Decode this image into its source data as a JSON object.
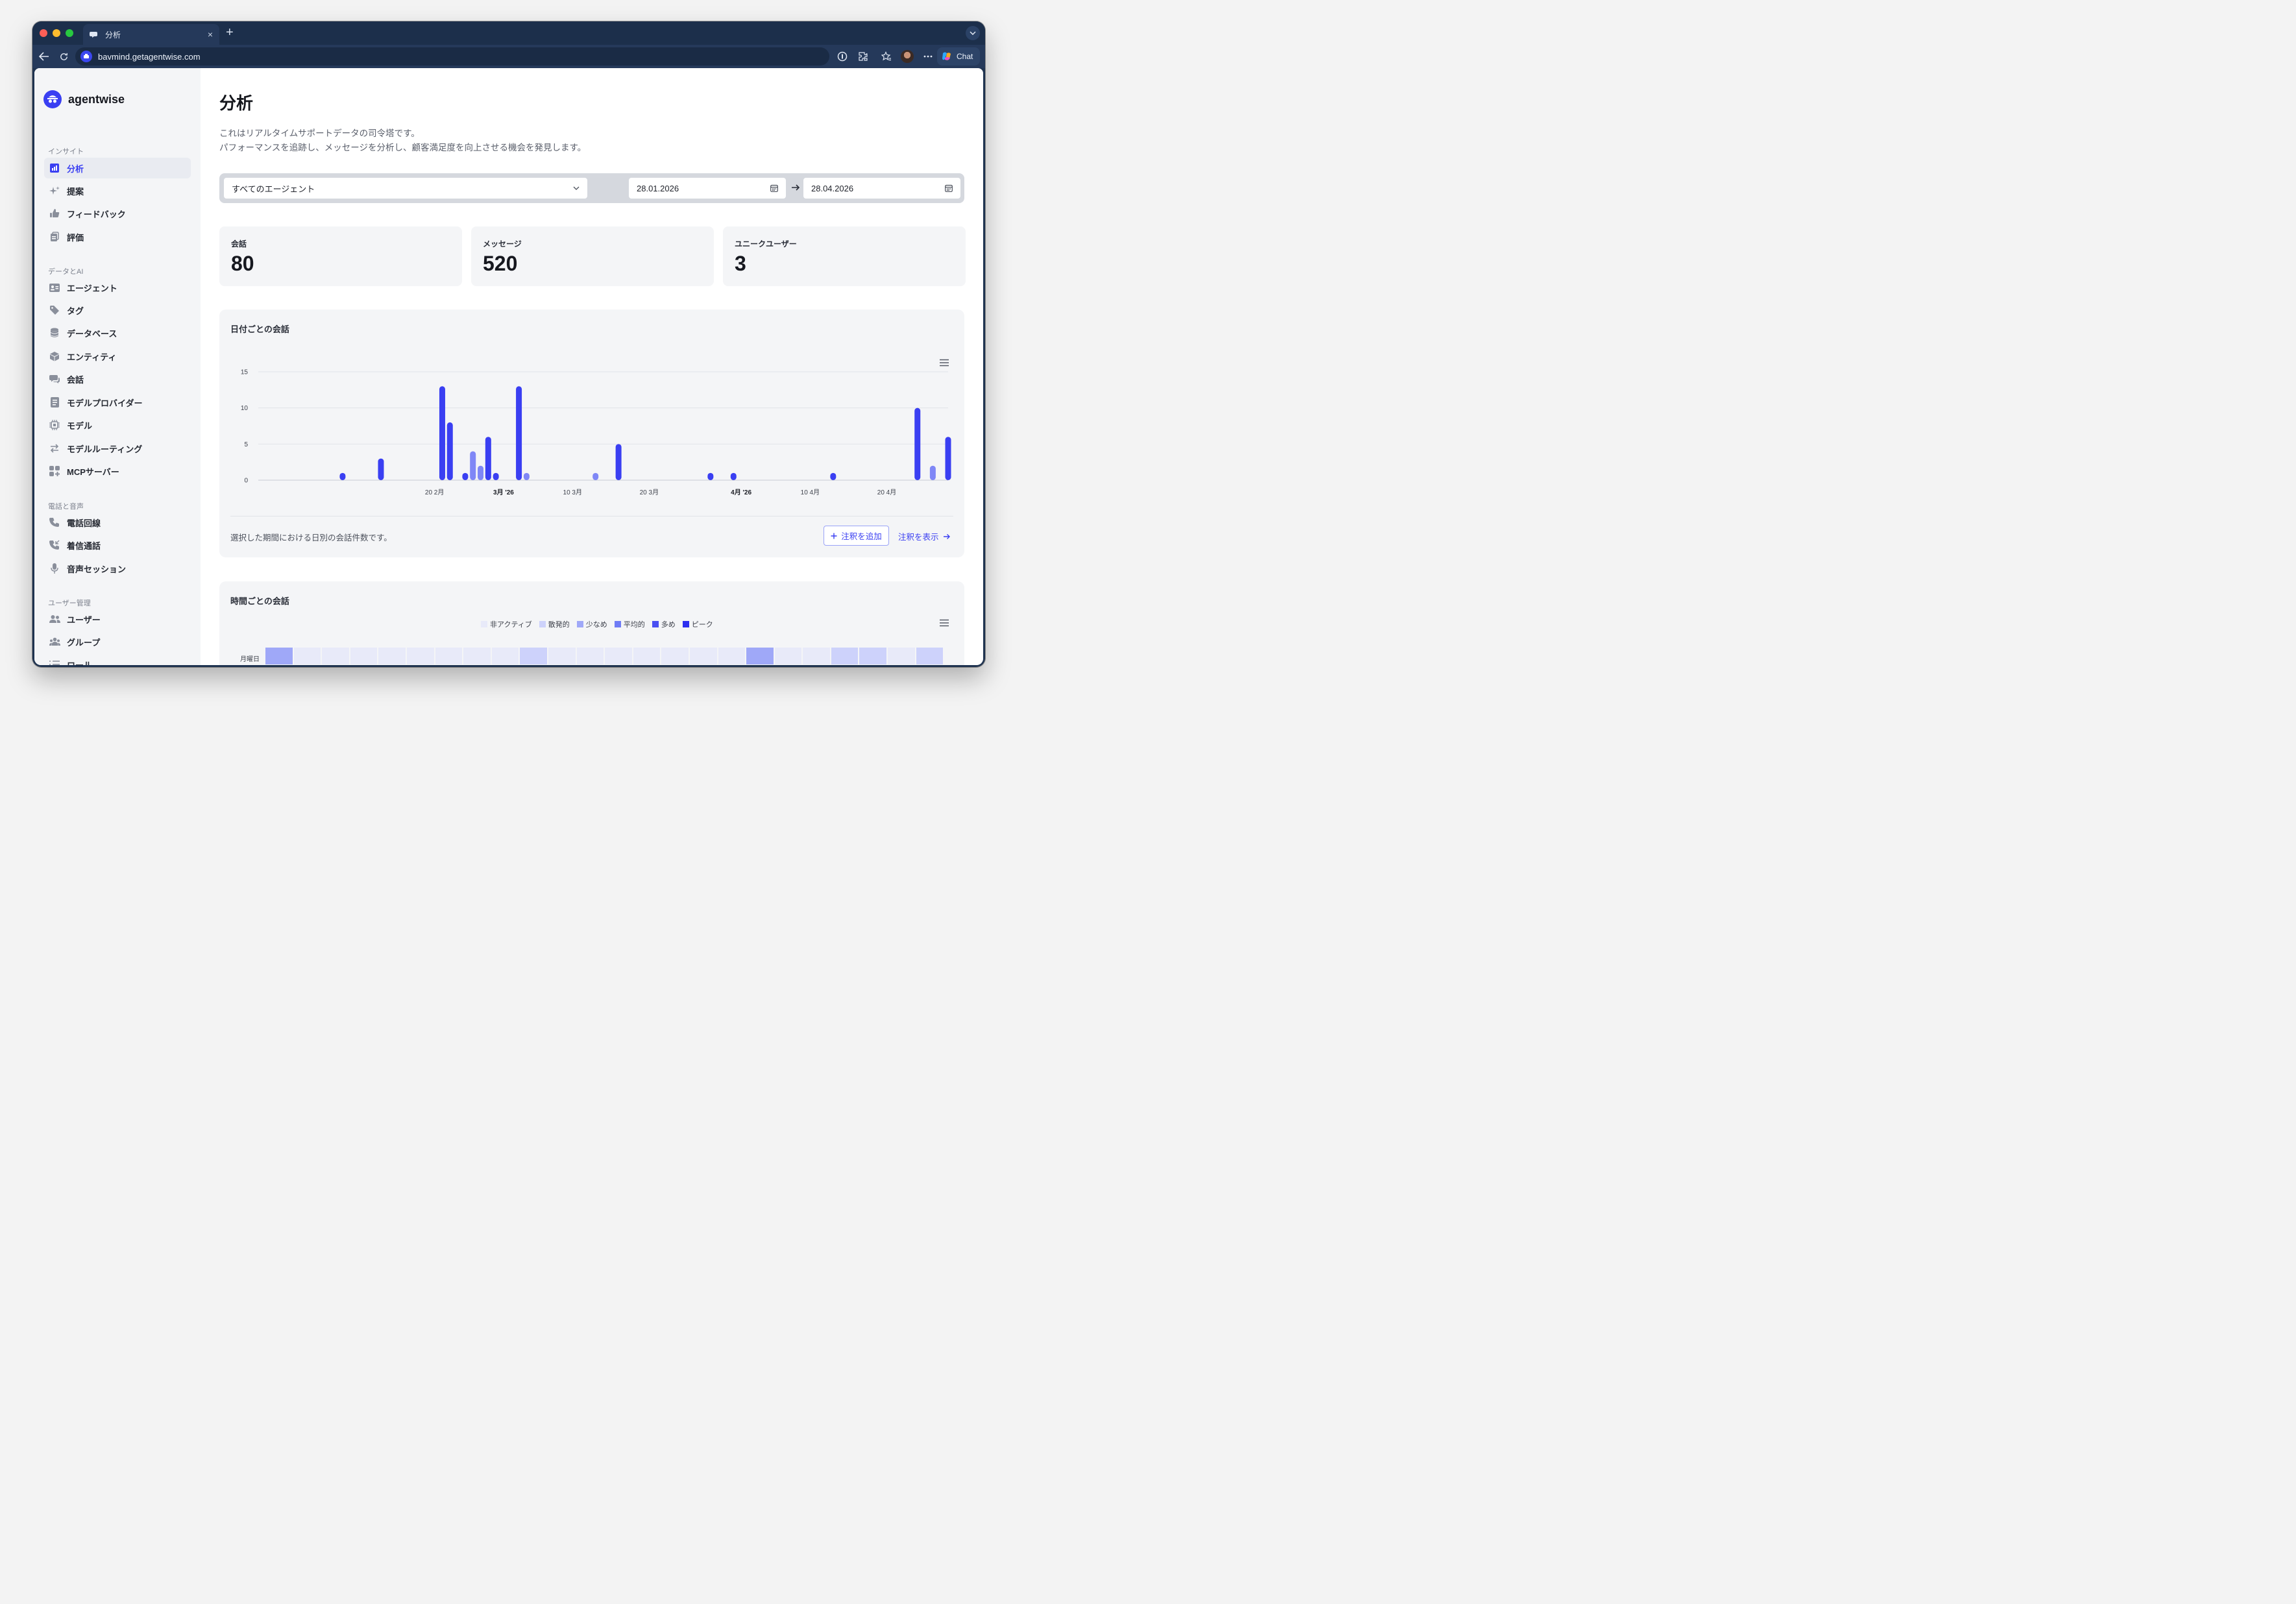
{
  "browser": {
    "tab_title": "分析",
    "tab_close": "×",
    "new_tab": "+",
    "url": "bavmind.getagentwise.com",
    "chat_label": "Chat"
  },
  "app": {
    "logo_text": "agentwise"
  },
  "sidebar": {
    "sections": [
      {
        "title": "インサイト",
        "items": [
          {
            "label": "分析",
            "icon": "bar-chart-icon",
            "active": true
          },
          {
            "label": "提案",
            "icon": "sparkles-icon"
          },
          {
            "label": "フィードバック",
            "icon": "thumbs-up-icon"
          },
          {
            "label": "評価",
            "icon": "clipboard-icon"
          }
        ]
      },
      {
        "title": "データとAI",
        "items": [
          {
            "label": "エージェント",
            "icon": "id-card-icon"
          },
          {
            "label": "タグ",
            "icon": "tag-icon"
          },
          {
            "label": "データベース",
            "icon": "database-icon"
          },
          {
            "label": "エンティティ",
            "icon": "cube-icon"
          },
          {
            "label": "会話",
            "icon": "chat-bubbles-icon"
          },
          {
            "label": "モデルプロバイダー",
            "icon": "document-icon"
          },
          {
            "label": "モデル",
            "icon": "chip-icon"
          },
          {
            "label": "モデルルーティング",
            "icon": "arrows-exchange-icon"
          },
          {
            "label": "MCPサーバー",
            "icon": "grid-plus-icon"
          }
        ]
      },
      {
        "title": "電話と音声",
        "items": [
          {
            "label": "電話回線",
            "icon": "phone-icon"
          },
          {
            "label": "着信通話",
            "icon": "phone-incoming-icon"
          },
          {
            "label": "音声セッション",
            "icon": "microphone-icon"
          }
        ]
      },
      {
        "title": "ユーザー管理",
        "items": [
          {
            "label": "ユーザー",
            "icon": "users-icon"
          },
          {
            "label": "グループ",
            "icon": "group-icon"
          },
          {
            "label": "ロール",
            "icon": "list-icon"
          }
        ]
      }
    ]
  },
  "main": {
    "title": "分析",
    "description": [
      "これはリアルタイムサポートデータの司令塔です。",
      "パフォーマンスを追跡し、メッセージを分析し、顧客満足度を向上させる機会を発見します。"
    ],
    "filters": {
      "agent_select": "すべてのエージェント",
      "date_from": "28.01.2026",
      "date_to": "28.04.2026"
    },
    "stats": [
      {
        "label": "会話",
        "value": "80"
      },
      {
        "label": "メッセージ",
        "value": "520"
      },
      {
        "label": "ユニークユーザー",
        "value": "3"
      }
    ],
    "daily_card": {
      "title": "日付ごとの会話",
      "footer_text": "選択した期間における日別の会話件数です。",
      "add_note": "注釈を追加",
      "show_notes": "注釈を表示"
    },
    "hourly_card": {
      "title": "時間ごとの会話",
      "legend": [
        {
          "label": "非アクティブ",
          "color": "#e8eaf9"
        },
        {
          "label": "散発的",
          "color": "#cdd2fb"
        },
        {
          "label": "少なめ",
          "color": "#9fa8f8"
        },
        {
          "label": "平均的",
          "color": "#6f7cf5"
        },
        {
          "label": "多め",
          "color": "#4a50f2"
        },
        {
          "label": "ピーク",
          "color": "#2d2ff0"
        }
      ],
      "row_label": "月曜日",
      "row_levels": [
        2,
        0,
        0,
        0,
        0,
        0,
        0,
        0,
        0,
        1,
        0,
        0,
        0,
        0,
        0,
        0,
        0,
        2,
        0,
        0,
        1,
        1,
        0,
        1
      ]
    }
  },
  "chart_data": [
    {
      "type": "bar",
      "title": "日付ごとの会話",
      "x_tick_labels": [
        "20 2月",
        "3月 '26",
        "10 3月",
        "20 3月",
        "4月 '26",
        "10 4月",
        "20 4月"
      ],
      "y_ticks": [
        0,
        5,
        10,
        15
      ],
      "ylim": [
        0,
        15
      ],
      "grid": true,
      "colors": {
        "bar": "#3a3ff2",
        "bar_light": "#7f87f6"
      },
      "x": [
        "2026-02-08",
        "2026-02-13",
        "2026-02-21",
        "2026-02-22",
        "2026-02-24",
        "2026-02-25",
        "2026-02-26",
        "2026-02-27",
        "2026-02-28",
        "2026-03-03",
        "2026-03-04",
        "2026-03-13",
        "2026-03-16",
        "2026-03-28",
        "2026-03-31",
        "2026-04-13",
        "2026-04-24",
        "2026-04-26",
        "2026-04-28"
      ],
      "values": [
        1,
        3,
        13,
        8,
        1,
        4,
        2,
        6,
        1,
        13,
        1,
        1,
        5,
        1,
        1,
        1,
        10,
        2,
        6
      ],
      "light": [
        false,
        false,
        false,
        false,
        false,
        true,
        true,
        false,
        false,
        false,
        true,
        true,
        false,
        false,
        false,
        false,
        false,
        true,
        false
      ]
    }
  ]
}
